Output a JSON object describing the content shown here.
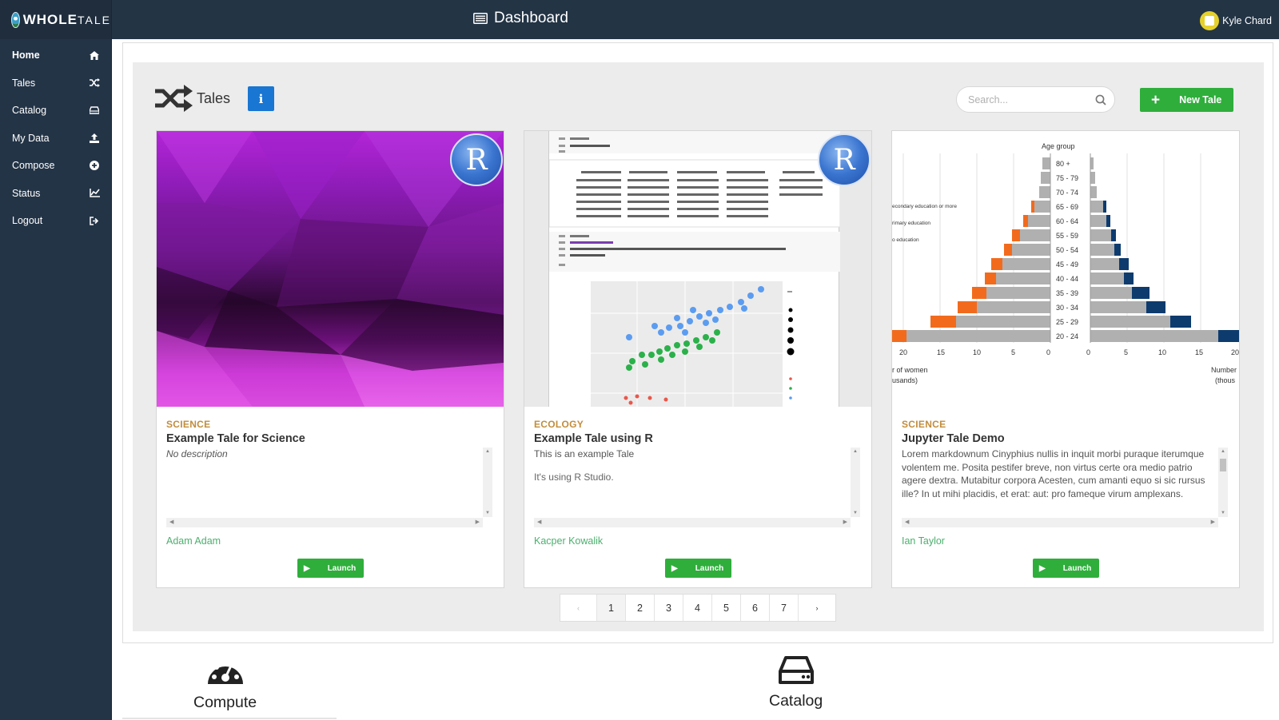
{
  "app": {
    "logo_bold": "WHOLE",
    "logo_light": "TALE",
    "page_title": "Dashboard",
    "user_name": "Kyle Chard"
  },
  "sidebar": {
    "items": [
      {
        "label": "Home",
        "icon": "home-icon"
      },
      {
        "label": "Tales",
        "icon": "shuffle-icon"
      },
      {
        "label": "Catalog",
        "icon": "drive-icon"
      },
      {
        "label": "My Data",
        "icon": "upload-icon"
      },
      {
        "label": "Compose",
        "icon": "plus-circle-icon"
      },
      {
        "label": "Status",
        "icon": "line-chart-icon"
      },
      {
        "label": "Logout",
        "icon": "sign-out-icon"
      }
    ]
  },
  "tales": {
    "heading": "Tales",
    "info_label": "i",
    "search_placeholder": "Search...",
    "new_button": "New Tale",
    "cards": [
      {
        "category": "SCIENCE",
        "title": "Example Tale for Science",
        "description": [
          "No description"
        ],
        "author": "Adam Adam",
        "launch": "Launch",
        "badge": "R"
      },
      {
        "category": "ECOLOGY",
        "title": "Example Tale using R",
        "description": [
          "This is an example Tale",
          "It's using R Studio."
        ],
        "author": "Kacper Kowalik",
        "launch": "Launch",
        "badge": "R"
      },
      {
        "category": "SCIENCE",
        "title": "Jupyter Tale Demo",
        "description": [
          "Lorem markdownum Cinyphius nullis in inquit morbi puraque iterumque volentem me. Posita pestifer breve, non virtus certe ora medio patrio agere dextra. Mutabitur corpora Acesten, cum amanti equo si sic rursus ille? In ut mihi placidis, et erat: aut: pro fameque virum amplexans."
        ],
        "author": "Ian Taylor",
        "launch": "Launch"
      }
    ],
    "pagination": [
      "‹",
      "1",
      "2",
      "3",
      "4",
      "5",
      "6",
      "7",
      "›"
    ],
    "active_page": "1"
  },
  "bottom": {
    "compute_label": "Compute",
    "catalog_label": "Catalog"
  },
  "colors": {
    "sidebar": "#243447",
    "topbar": "#233445",
    "accent_green": "#2fae3c",
    "info_blue": "#1976d2",
    "category": "#c28d3c",
    "author": "#4caf6e"
  }
}
